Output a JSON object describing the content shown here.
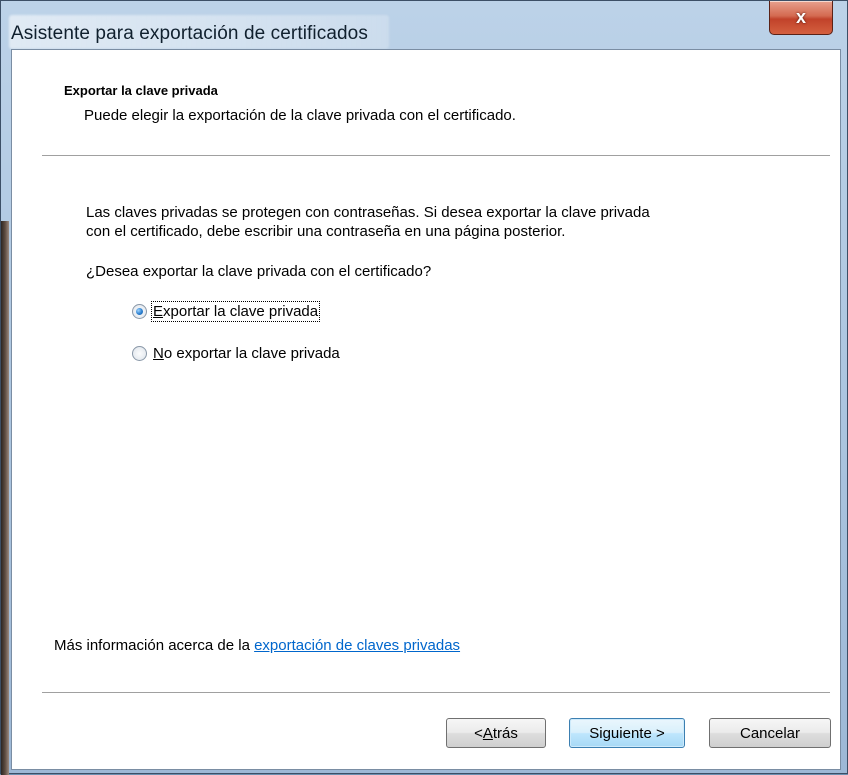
{
  "window": {
    "title": "Asistente para exportación de certificados",
    "close_glyph": "x"
  },
  "header": {
    "title": "Exportar la clave privada",
    "subtitle": "Puede elegir la exportación de la clave privada con el certificado."
  },
  "body": {
    "description_line1": "Las claves privadas se protegen con contraseñas. Si desea exportar la clave privada",
    "description_line2": "con el certificado, debe escribir una contraseña en una página posterior.",
    "question": "¿Desea exportar la clave privada con el certificado?",
    "options": [
      {
        "mnemonic": "E",
        "rest": "xportar la clave privada",
        "selected": true
      },
      {
        "mnemonic": "N",
        "rest": "o exportar la clave privada",
        "selected": false
      }
    ]
  },
  "footer": {
    "more_info_prefix": "Más información acerca de la ",
    "more_info_link": "exportación de claves privadas",
    "back_prefix": "< ",
    "back_mnemonic": "A",
    "back_rest": "trás",
    "next_label": "Siguiente >",
    "cancel_label": "Cancelar"
  },
  "colors": {
    "link": "#0066cc",
    "close_button": "#c1422a",
    "default_button_border": "#3c7fb1"
  }
}
